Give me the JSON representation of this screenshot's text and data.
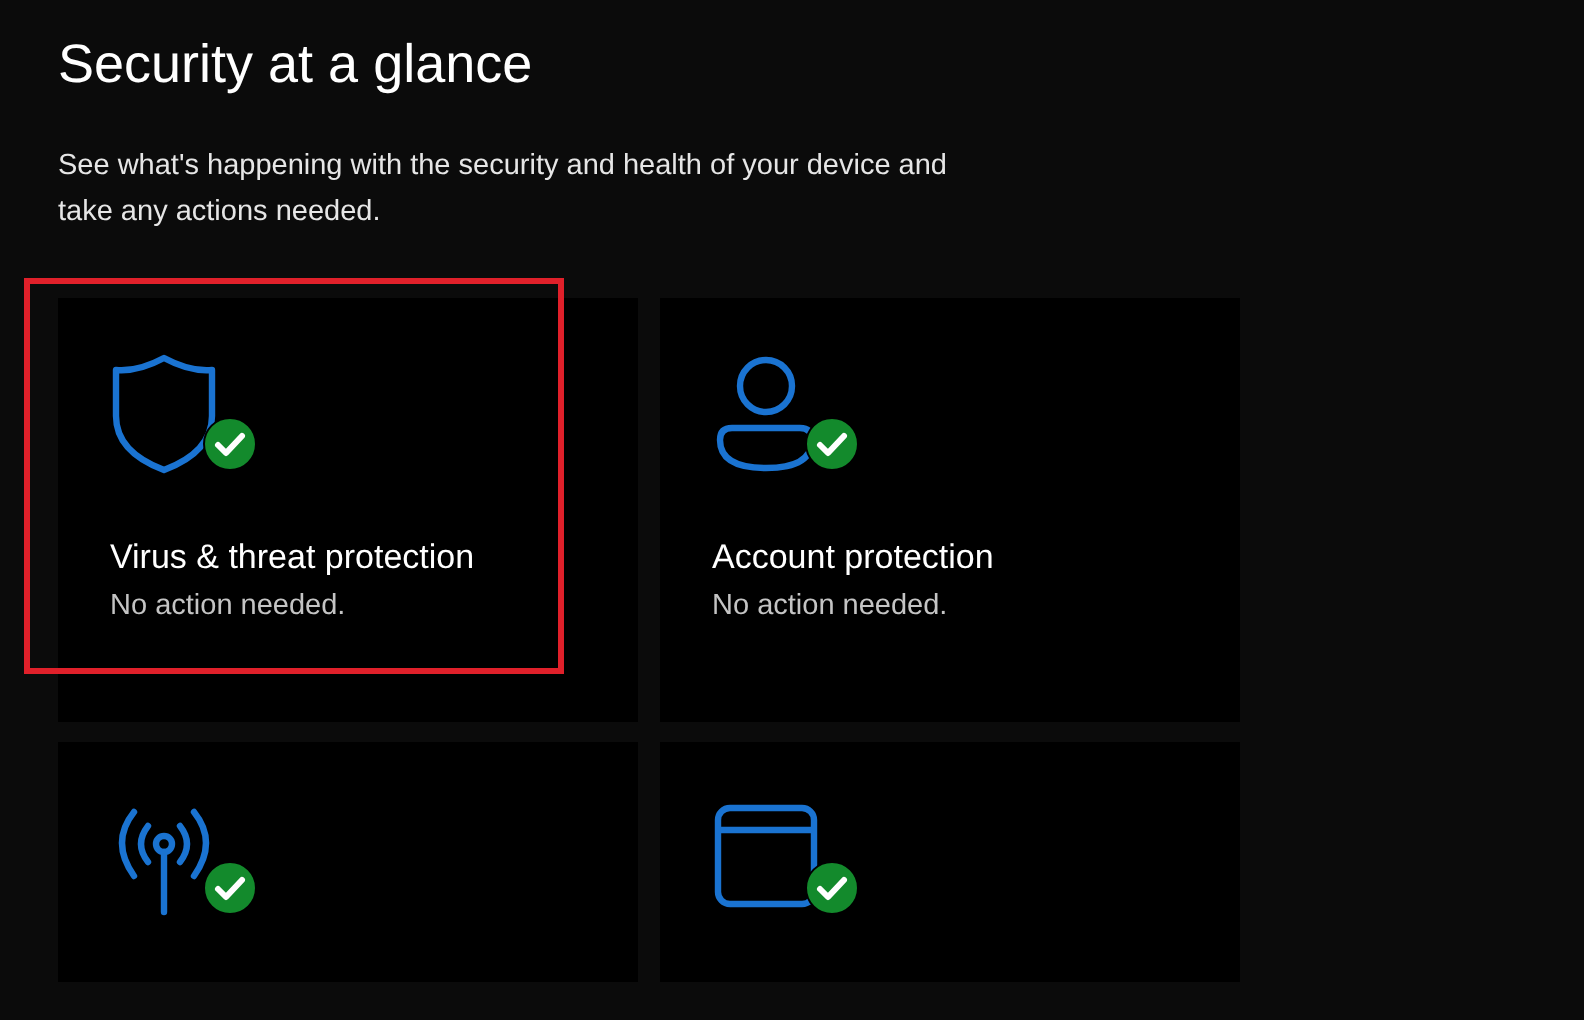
{
  "header": {
    "title": "Security at a glance",
    "description": "See what's happening with the security and health of your device and take any actions needed."
  },
  "cards": [
    {
      "kind": "shield",
      "title": "Virus & threat protection",
      "status_text": "No action needed.",
      "protected": true,
      "highlighted": true
    },
    {
      "kind": "person",
      "title": "Account protection",
      "status_text": "No action needed.",
      "protected": true,
      "highlighted": false
    },
    {
      "kind": "antenna",
      "protected": true,
      "highlighted": false
    },
    {
      "kind": "window",
      "protected": true,
      "highlighted": false
    }
  ]
}
